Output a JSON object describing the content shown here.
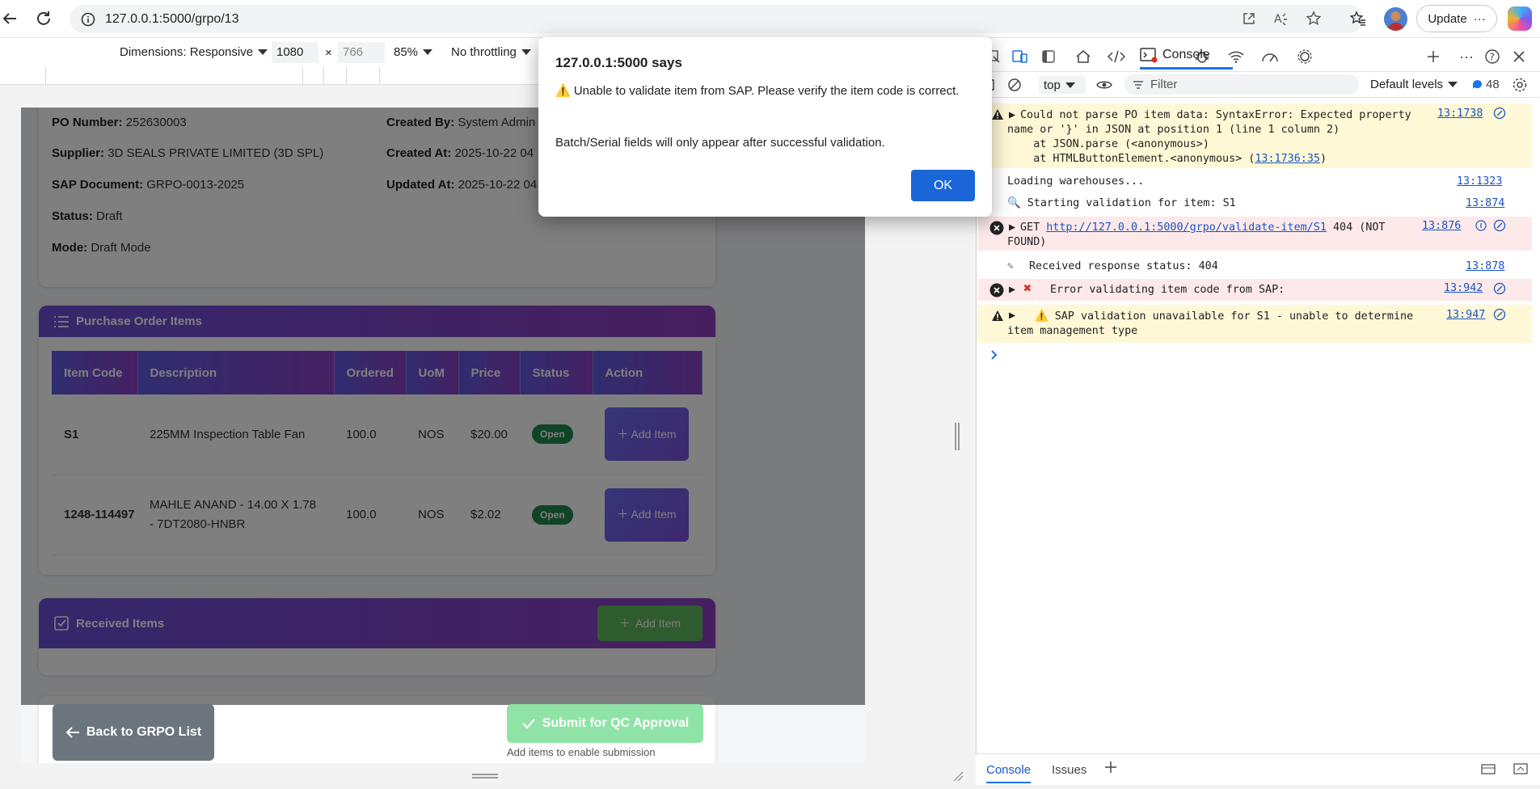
{
  "browser": {
    "url": "127.0.0.1:5000/grpo/13",
    "update_label": "Update"
  },
  "device_toolbar": {
    "dimensions_label": "Dimensions: Responsive",
    "width": "1080",
    "times": "×",
    "height": "766",
    "zoom": "85%",
    "throttling": "No throttling"
  },
  "po_details": {
    "po_number_label": "PO Number:",
    "po_number": "252630003",
    "supplier_label": "Supplier:",
    "supplier": "3D SEALS PRIVATE LIMITED (3D SPL)",
    "sap_doc_label": "SAP Document:",
    "sap_doc": "GRPO-0013-2025",
    "status_label": "Status:",
    "status": "Draft",
    "mode_label": "Mode:",
    "mode": "Draft Mode",
    "created_by_label": "Created By:",
    "created_by": "System Admin",
    "created_at_label": "Created At:",
    "created_at": "2025-10-22 04",
    "updated_at_label": "Updated At:",
    "updated_at": "2025-10-22 04"
  },
  "po_items": {
    "title": "Purchase Order Items",
    "columns": [
      "Item Code",
      "Description",
      "Ordered",
      "UoM",
      "Price",
      "Status",
      "Action"
    ],
    "rows": [
      {
        "code": "S1",
        "description": "225MM Inspection Table Fan",
        "ordered": "100.0",
        "uom": "NOS",
        "price": "$20.00",
        "status": "Open",
        "action": "Add Item"
      },
      {
        "code": "1248-114497",
        "description": "MAHLE ANAND - 14.00 X 1.78 - 7DT2080-HNBR",
        "ordered": "100.0",
        "uom": "NOS",
        "price": "$2.02",
        "status": "Open",
        "action": "Add Item"
      }
    ]
  },
  "received": {
    "title": "Received Items",
    "add_label": "Add Item"
  },
  "footer": {
    "back_label": "Back to GRPO List",
    "submit_label": "Submit for QC Approval",
    "hint": "Add items to enable submission"
  },
  "alert": {
    "title": "127.0.0.1:5000 says",
    "line1": "⚠️ Unable to validate item from SAP. Please verify the item code is correct.",
    "line2": "Batch/Serial fields will only appear after successful validation.",
    "ok_label": "OK"
  },
  "devtools": {
    "console_tab": "Console",
    "context": "top",
    "filter_placeholder": "Filter",
    "levels": "Default levels",
    "msg_count": "48",
    "bottom_tabs": [
      "Console",
      "Issues"
    ]
  },
  "console": {
    "m1_text": "Could not parse PO item data: SyntaxError: Expected property name or '}' in JSON at position 1 (line 1 column 2)",
    "m1_line2": "    at JSON.parse (<anonymous>)",
    "m1_line3a": "    at HTMLButtonElement.<anonymous> (",
    "m1_line3link": "13:1736:35",
    "m1_line3b": ")",
    "m1_src": "13:1738",
    "m2_text": "Loading warehouses...",
    "m2_src": "13:1323",
    "m3_text": "🔍 Starting validation for item: S1",
    "m3_src": "13:874",
    "m4_method": "GET",
    "m4_url": "http://127.0.0.1:5000/grpo/validate-item/S1",
    "m4_status": "404 (NOT FOUND)",
    "m4_src": "13:876",
    "m5_text": "Received response status: 404",
    "m5_src": "13:878",
    "m6_text": "Error validating item code from SAP:",
    "m6_src": "13:942",
    "m7_text": "⚠️ SAP validation unavailable for S1 - unable to determine item management type",
    "m7_src": "13:947"
  }
}
